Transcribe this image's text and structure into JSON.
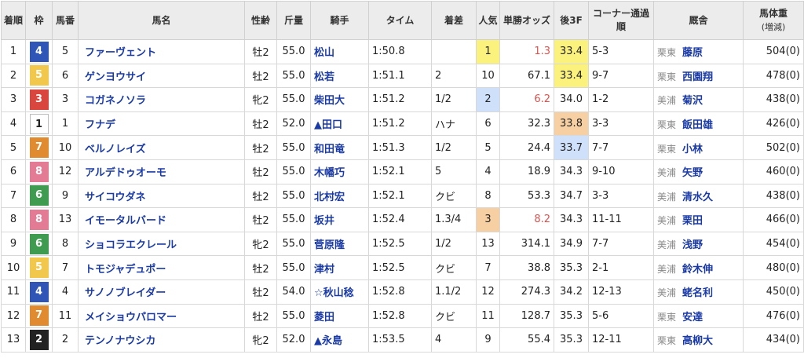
{
  "headers": {
    "rank": "着順",
    "waku": "枠",
    "umaban": "馬番",
    "name": "馬名",
    "sexage": "性齢",
    "weight": "斤量",
    "jockey": "騎手",
    "time": "タイム",
    "margin": "着差",
    "pop": "人気",
    "odds": "単勝オッズ",
    "last3f": "後3F",
    "corner": "コーナー通過順",
    "trainer": "厩舎",
    "bodyweight": "馬体重",
    "bodyweight_sub": "(増減)"
  },
  "waku_colors": {
    "1": "#ffffff",
    "2": "#222222",
    "3": "#d9463e",
    "4": "#2f55b6",
    "5": "#f1c84b",
    "6": "#3f9b4f",
    "7": "#e08b2f",
    "8": "#e47b95"
  },
  "rows": [
    {
      "rank": "1",
      "waku": "4",
      "umaban": "5",
      "name": "ファーヴェント",
      "sexage": "牡2",
      "weight": "55.0",
      "jockey": "松山",
      "time": "1:50.8",
      "margin": "",
      "pop": "1",
      "odds": "1.3",
      "last3f": "33.4",
      "corner": "5-3",
      "stable": "栗東",
      "trainer": "藤原",
      "bodyweight": "504(0)",
      "pop_hl": "yellow",
      "l3f_hl": "yellow",
      "odds_red": true
    },
    {
      "rank": "2",
      "waku": "5",
      "umaban": "6",
      "name": "ゲンヨウサイ",
      "sexage": "牡2",
      "weight": "55.0",
      "jockey": "松若",
      "time": "1:51.1",
      "margin": "2",
      "pop": "10",
      "odds": "67.1",
      "last3f": "33.4",
      "corner": "9-7",
      "stable": "栗東",
      "trainer": "西園翔",
      "bodyweight": "478(0)",
      "pop_hl": "",
      "l3f_hl": "yellow",
      "odds_red": false
    },
    {
      "rank": "3",
      "waku": "3",
      "umaban": "3",
      "name": "コガネノソラ",
      "sexage": "牝2",
      "weight": "55.0",
      "jockey": "柴田大",
      "time": "1:51.2",
      "margin": "1/2",
      "pop": "2",
      "odds": "6.2",
      "last3f": "34.0",
      "corner": "1-2",
      "stable": "美浦",
      "trainer": "菊沢",
      "bodyweight": "438(0)",
      "pop_hl": "blue",
      "l3f_hl": "",
      "odds_red": true
    },
    {
      "rank": "4",
      "waku": "1",
      "umaban": "1",
      "name": "フナデ",
      "sexage": "牡2",
      "weight": "52.0",
      "jockey": "▲田口",
      "time": "1:51.2",
      "margin": "ハナ",
      "pop": "6",
      "odds": "32.3",
      "last3f": "33.8",
      "corner": "3-3",
      "stable": "栗東",
      "trainer": "飯田雄",
      "bodyweight": "426(0)",
      "pop_hl": "",
      "l3f_hl": "orange",
      "odds_red": false
    },
    {
      "rank": "5",
      "waku": "7",
      "umaban": "10",
      "name": "ベルノレイズ",
      "sexage": "牡2",
      "weight": "55.0",
      "jockey": "和田竜",
      "time": "1:51.3",
      "margin": "1/2",
      "pop": "5",
      "odds": "24.4",
      "last3f": "33.7",
      "corner": "7-7",
      "stable": "栗東",
      "trainer": "小林",
      "bodyweight": "502(0)",
      "pop_hl": "",
      "l3f_hl": "blue",
      "odds_red": false
    },
    {
      "rank": "6",
      "waku": "8",
      "umaban": "12",
      "name": "アルデドゥオーモ",
      "sexage": "牡2",
      "weight": "55.0",
      "jockey": "木幡巧",
      "time": "1:52.1",
      "margin": "5",
      "pop": "4",
      "odds": "18.9",
      "last3f": "34.3",
      "corner": "9-10",
      "stable": "美浦",
      "trainer": "矢野",
      "bodyweight": "460(0)",
      "pop_hl": "",
      "l3f_hl": "",
      "odds_red": false
    },
    {
      "rank": "7",
      "waku": "6",
      "umaban": "9",
      "name": "サイコウダネ",
      "sexage": "牡2",
      "weight": "55.0",
      "jockey": "北村宏",
      "time": "1:52.1",
      "margin": "クビ",
      "pop": "8",
      "odds": "53.3",
      "last3f": "34.7",
      "corner": "3-3",
      "stable": "美浦",
      "trainer": "清水久",
      "bodyweight": "438(0)",
      "pop_hl": "",
      "l3f_hl": "",
      "odds_red": false
    },
    {
      "rank": "8",
      "waku": "8",
      "umaban": "13",
      "name": "イモータルバード",
      "sexage": "牡2",
      "weight": "55.0",
      "jockey": "坂井",
      "time": "1:52.4",
      "margin": "1.3/4",
      "pop": "3",
      "odds": "8.2",
      "last3f": "34.3",
      "corner": "11-11",
      "stable": "美浦",
      "trainer": "栗田",
      "bodyweight": "466(0)",
      "pop_hl": "orange",
      "l3f_hl": "",
      "odds_red": true
    },
    {
      "rank": "9",
      "waku": "6",
      "umaban": "8",
      "name": "ショコラエクレール",
      "sexage": "牝2",
      "weight": "55.0",
      "jockey": "菅原隆",
      "time": "1:52.5",
      "margin": "1/2",
      "pop": "13",
      "odds": "314.1",
      "last3f": "34.9",
      "corner": "7-7",
      "stable": "美浦",
      "trainer": "浅野",
      "bodyweight": "454(0)",
      "pop_hl": "",
      "l3f_hl": "",
      "odds_red": false
    },
    {
      "rank": "10",
      "waku": "5",
      "umaban": "7",
      "name": "トモジャデュポー",
      "sexage": "牡2",
      "weight": "55.0",
      "jockey": "津村",
      "time": "1:52.5",
      "margin": "クビ",
      "pop": "7",
      "odds": "38.8",
      "last3f": "35.3",
      "corner": "2-1",
      "stable": "美浦",
      "trainer": "鈴木伸",
      "bodyweight": "480(0)",
      "pop_hl": "",
      "l3f_hl": "",
      "odds_red": false
    },
    {
      "rank": "11",
      "waku": "4",
      "umaban": "4",
      "name": "サノノブレイダー",
      "sexage": "牡2",
      "weight": "54.0",
      "jockey": "☆秋山稔",
      "time": "1:52.8",
      "margin": "1.1/2",
      "pop": "12",
      "odds": "274.3",
      "last3f": "34.2",
      "corner": "12-13",
      "stable": "美浦",
      "trainer": "蛯名利",
      "bodyweight": "450(0)",
      "pop_hl": "",
      "l3f_hl": "",
      "odds_red": false
    },
    {
      "rank": "12",
      "waku": "7",
      "umaban": "11",
      "name": "メイショウパロマー",
      "sexage": "牡2",
      "weight": "55.0",
      "jockey": "菱田",
      "time": "1:52.8",
      "margin": "クビ",
      "pop": "11",
      "odds": "128.7",
      "last3f": "35.3",
      "corner": "5-6",
      "stable": "栗東",
      "trainer": "安達",
      "bodyweight": "476(0)",
      "pop_hl": "",
      "l3f_hl": "",
      "odds_red": false
    },
    {
      "rank": "13",
      "waku": "2",
      "umaban": "2",
      "name": "テンノナウシカ",
      "sexage": "牝2",
      "weight": "52.0",
      "jockey": "▲永島",
      "time": "1:53.5",
      "margin": "4",
      "pop": "9",
      "odds": "55.4",
      "last3f": "35.3",
      "corner": "12-11",
      "stable": "栗東",
      "trainer": "高柳大",
      "bodyweight": "434(0)",
      "pop_hl": "",
      "l3f_hl": "",
      "odds_red": false
    }
  ]
}
